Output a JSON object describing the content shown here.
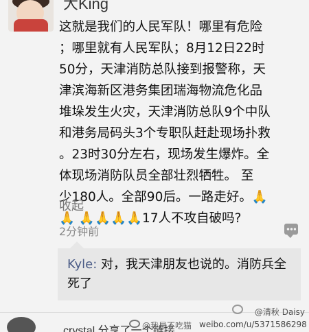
{
  "post": {
    "username": "大King",
    "lines": [
      "这就是我们的人民军队！哪里有危险",
      "；哪里就有人民军队；8月12日22时",
      "50分，天津消防总队接到报警称，天",
      "津滨海新区港务集团瑞海物流危化品",
      "堆垛发生火灾，天津消防总队9个中队",
      "和港务局码头3个专职队赶赴现场扑救",
      "。23时30分左右，现场发生爆炸。全",
      "体现场消防队员全部壮烈牺牲。 至",
      "少180人。全部90后。一路走好。🙏",
      "🙏 🙏🙏🙏🙏17人不攻自破吗?"
    ],
    "collapse_label": "收起",
    "timestamp": "2分钟前",
    "comment_icon": "comment-bubble-icon"
  },
  "reply": {
    "name": "Kyle:",
    "text": " 对，我天津朋友也说的。消防兵全死了"
  },
  "next": {
    "snippet": "crystal 分享了一个链接"
  },
  "watermark": {
    "nick": "@我是不吃猫",
    "url": "weibo.com/u/5371586298",
    "user": "@清秋 Daisy"
  }
}
